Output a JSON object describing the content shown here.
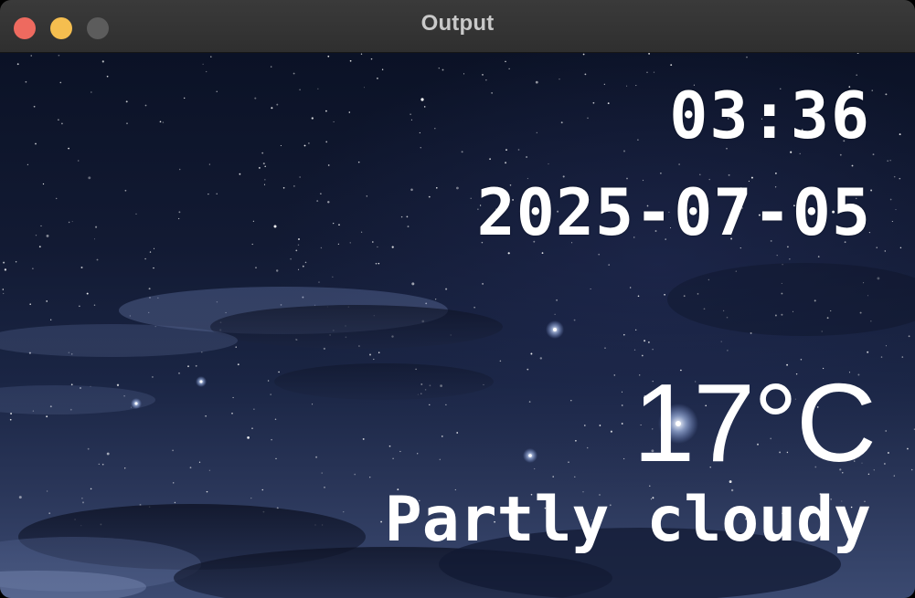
{
  "window": {
    "title": "Output",
    "colors": {
      "close": "#ee6a5f",
      "minimize": "#f5be4f",
      "maximize": "#5c5c5c"
    }
  },
  "weather_display": {
    "time": "03:36",
    "date": "2025-07-05",
    "temperature": "17°C",
    "condition": "Partly cloudy",
    "text_color": "#ffffff"
  }
}
